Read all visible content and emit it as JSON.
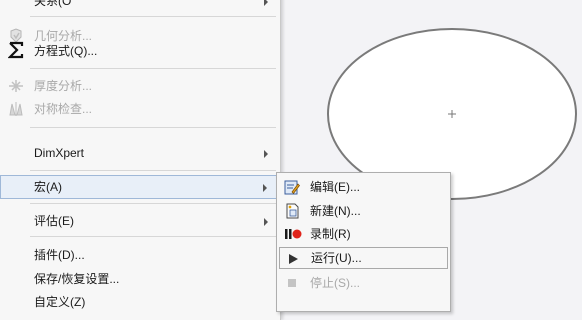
{
  "menu": {
    "items": [
      {
        "label": "关系(O",
        "icon": "relations-icon",
        "disabled": false
      },
      {
        "label": "几何分析...",
        "icon": "geometry-analysis-icon",
        "disabled": true
      },
      {
        "label": "方程式(Q)...",
        "icon": "sigma-icon",
        "disabled": false
      },
      {
        "label": "厚度分析...",
        "icon": "thickness-analysis-icon",
        "disabled": true
      },
      {
        "label": "对称检查...",
        "icon": "symmetry-check-icon",
        "disabled": true
      },
      {
        "label": "DimXpert",
        "icon": "",
        "disabled": false
      },
      {
        "label": "宏(A)",
        "icon": "",
        "disabled": false
      },
      {
        "label": "评估(E)",
        "icon": "",
        "disabled": false
      },
      {
        "label": "插件(D)...",
        "icon": "",
        "disabled": false
      },
      {
        "label": "保存/恢复设置...",
        "icon": "",
        "disabled": false
      },
      {
        "label": "自定义(Z)",
        "icon": "",
        "disabled": false
      }
    ]
  },
  "submenu": {
    "items": [
      {
        "label": "编辑(E)...",
        "icon": "edit-macro-icon"
      },
      {
        "label": "新建(N)...",
        "icon": "new-macro-icon"
      },
      {
        "label": "录制(R)",
        "icon": "record-pause-icon"
      },
      {
        "label": "运行(U)...",
        "icon": "play-icon"
      },
      {
        "label": "停止(S)...",
        "icon": "stop-icon",
        "disabled": true
      }
    ]
  },
  "colors": {
    "record": "#e0241b",
    "sketch": "#7a7a7a",
    "highlight": "#e8eff8"
  }
}
